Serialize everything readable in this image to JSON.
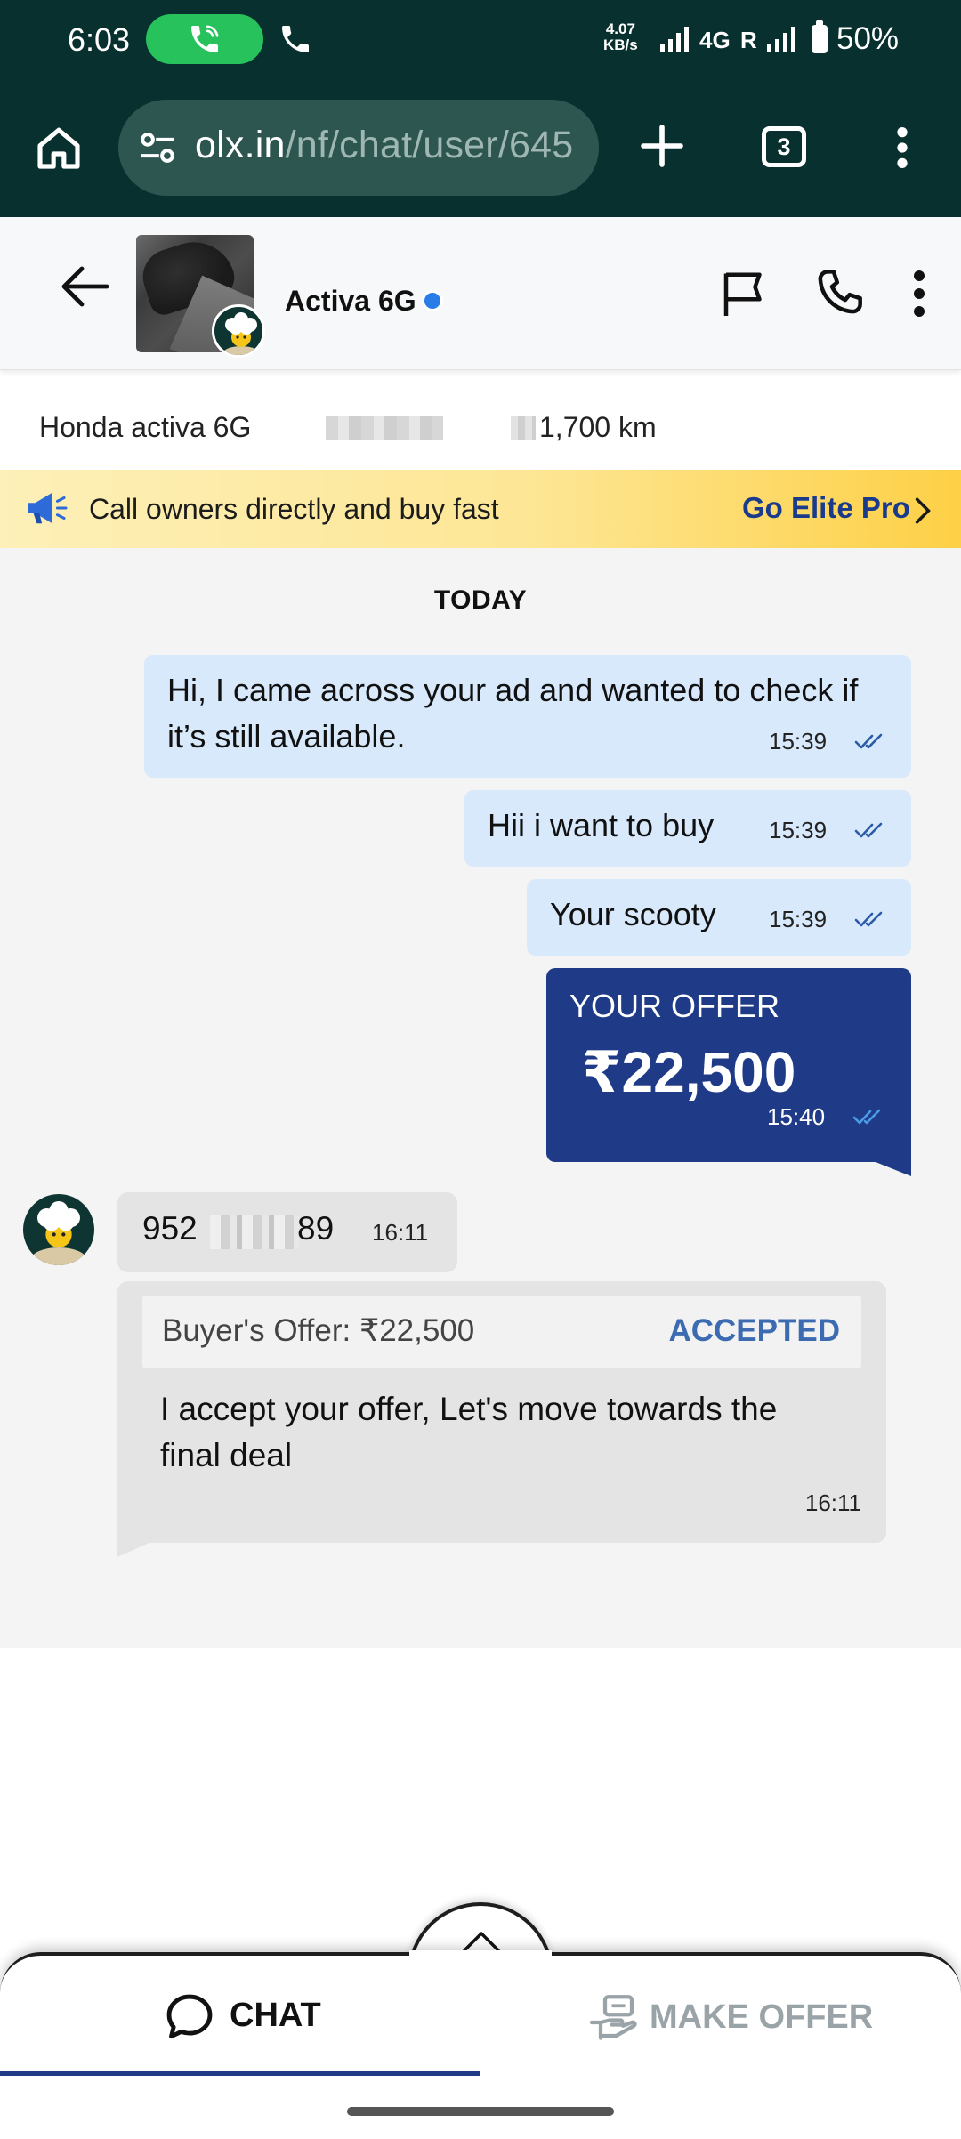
{
  "status_bar": {
    "time": "6:03",
    "net_speed_value": "4.07",
    "net_speed_unit": "KB/s",
    "network_type": "4G",
    "roaming": "R",
    "battery": "50%"
  },
  "browser": {
    "url_host": "olx.in",
    "url_path": "/nf/chat/user/645",
    "tab_count": "3"
  },
  "chat_header": {
    "title": "Activa 6G"
  },
  "ad_info": {
    "name": "Honda activa 6G",
    "km": "1,700 km"
  },
  "promo": {
    "text": "Call owners directly and buy fast",
    "cta": "Go Elite Pro"
  },
  "chat": {
    "day_label": "TODAY",
    "messages": [
      {
        "text": "Hi, I came across your ad and wanted to check if it’s still available.",
        "time": "15:39"
      },
      {
        "text": "Hii i want to buy",
        "time": "15:39"
      },
      {
        "text": "Your scooty",
        "time": "15:39"
      }
    ],
    "offer": {
      "label": "YOUR OFFER",
      "amount": "₹22,500",
      "time": "15:40"
    },
    "incoming_phone": {
      "start": "952",
      "end": "89",
      "time": "16:11"
    },
    "acceptance": {
      "offer_label": "Buyer's Offer:  ₹22,500",
      "status": "ACCEPTED",
      "text": "I accept your offer, Let's move towards the final deal",
      "time": "16:11"
    }
  },
  "bottom_bar": {
    "chat_label": "CHAT",
    "make_offer_label": "MAKE OFFER"
  },
  "colors": {
    "browser_bg": "#08302e",
    "offer_card": "#1f3b87",
    "outgoing_bubble": "#d8e9fb",
    "incoming_bubble": "#e4e4e4",
    "accepted": "#3c6bb1",
    "promo_cta": "#1a3b8c"
  },
  "icons": [
    "call-active-icon",
    "phone-icon",
    "signal-icon",
    "battery-icon",
    "home-icon",
    "site-settings-icon",
    "plus-icon",
    "tabs-icon",
    "overflow-menu-icon",
    "back-arrow-icon",
    "verified-icon",
    "flag-icon",
    "call-icon",
    "more-vert-icon",
    "megaphone-icon",
    "chevron-right-icon",
    "double-tick-icon",
    "chat-bubble-icon",
    "make-offer-icon",
    "caret-up-icon"
  ]
}
